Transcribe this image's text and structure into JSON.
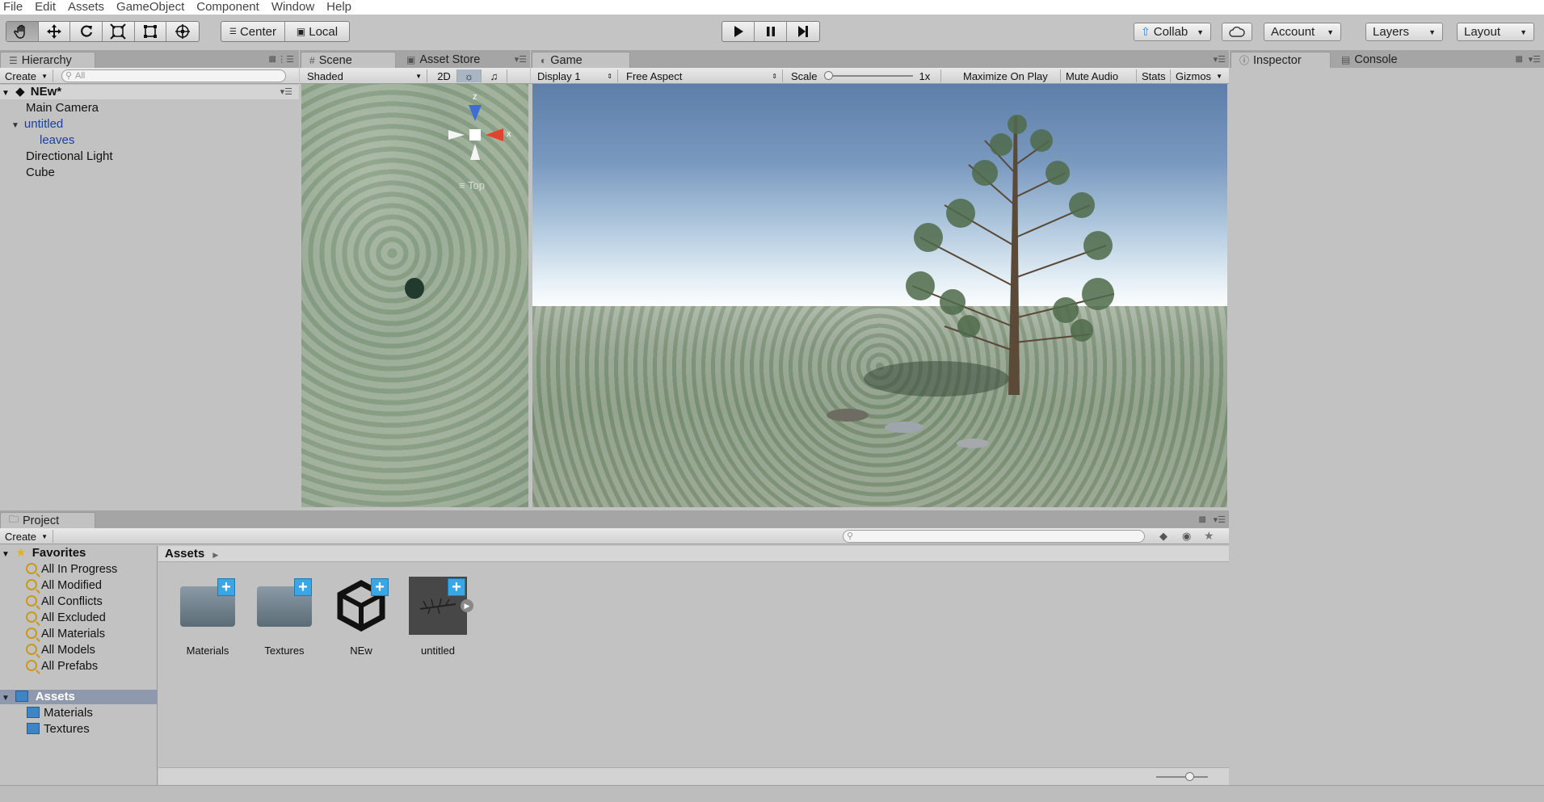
{
  "menu": [
    "File",
    "Edit",
    "Assets",
    "GameObject",
    "Component",
    "Window",
    "Help"
  ],
  "toolbar": {
    "pivot_label": "Center",
    "space_label": "Local",
    "collab_label": "Collab",
    "account_label": "Account",
    "layers_label": "Layers",
    "layout_label": "Layout"
  },
  "hierarchy": {
    "tab": "Hierarchy",
    "create": "Create",
    "search_placeholder": "All",
    "scene_name": "NEw*",
    "items": [
      {
        "label": "Main Camera"
      },
      {
        "label": "untitled"
      },
      {
        "label": "leaves"
      },
      {
        "label": "Directional Light"
      },
      {
        "label": "Cube"
      }
    ]
  },
  "scene": {
    "tab": "Scene",
    "asset_store_tab": "Asset Store",
    "shading": "Shaded",
    "mode_2d": "2D",
    "gizmo_axis_z": "z",
    "gizmo_axis_x": "x",
    "view_label": "Top"
  },
  "game": {
    "tab": "Game",
    "display": "Display 1",
    "aspect": "Free Aspect",
    "scale_label": "Scale",
    "scale_value": "1x",
    "maximize": "Maximize On Play",
    "mute": "Mute Audio",
    "stats": "Stats",
    "gizmos": "Gizmos"
  },
  "inspector": {
    "tab": "Inspector",
    "console_tab": "Console"
  },
  "project": {
    "tab": "Project",
    "create": "Create",
    "breadcrumb": "Assets",
    "favorites_label": "Favorites",
    "favorites": [
      "All In Progress",
      "All Modified",
      "All Conflicts",
      "All Excluded",
      "All Materials",
      "All Models",
      "All Prefabs"
    ],
    "assets_root": "Assets",
    "asset_folders": [
      "Materials",
      "Textures"
    ],
    "tiles": [
      {
        "label": "Materials",
        "kind": "folder"
      },
      {
        "label": "Textures",
        "kind": "folder"
      },
      {
        "label": "NEw",
        "kind": "unity-scene"
      },
      {
        "label": "untitled",
        "kind": "model"
      }
    ]
  },
  "colors": {
    "accent_blue": "#3aa6e4",
    "selection_blue": "#1b3f9c",
    "panel_bg": "#c2c2c2"
  }
}
